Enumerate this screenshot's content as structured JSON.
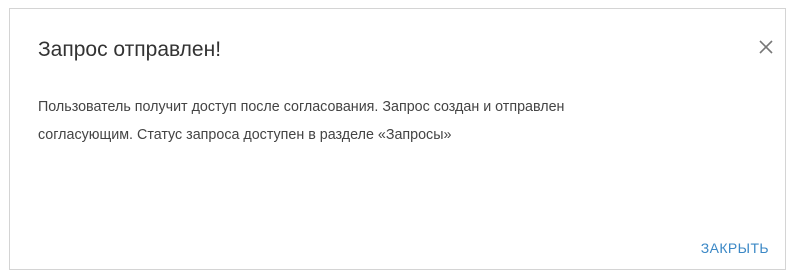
{
  "dialog": {
    "title": "Запрос отправлен!",
    "close_icon": "close-icon",
    "message_line1": "Пользователь получит доступ после согласования. Запрос создан и отправлен",
    "message_line2": "согласующим. Статус запроса доступен в разделе «Запросы»",
    "close_button_label": "ЗАКРЫТЬ"
  },
  "colors": {
    "accent": "#3b88c6",
    "title_text": "#333333",
    "body_text": "#444444",
    "border": "#d4d4d4"
  }
}
